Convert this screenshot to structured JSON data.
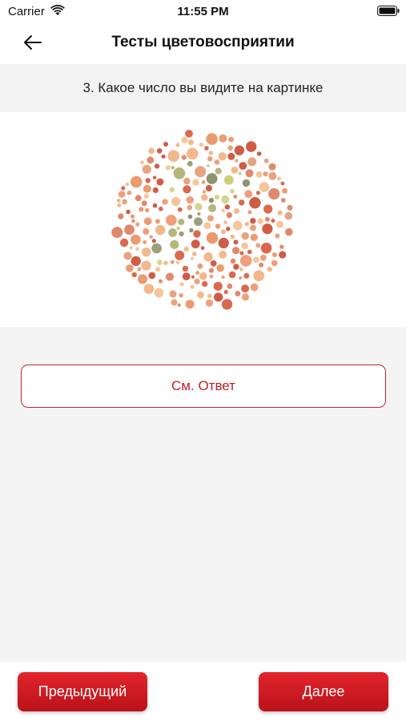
{
  "status_bar": {
    "carrier": "Carrier",
    "time": "11:55 PM",
    "icons": [
      "wifi-icon",
      "battery-icon"
    ]
  },
  "nav": {
    "title": "Тесты цветовосприятии",
    "back_icon": "arrow-left-icon"
  },
  "question": {
    "text": "3. Какое число вы видите на картинке"
  },
  "plate": {
    "icon": "ishihara-color-plate",
    "background_colors": [
      "#e08a6b",
      "#ef9f7c",
      "#f2b98c",
      "#d9694f",
      "#e7a37f",
      "#f5c59b",
      "#cf5d45",
      "#eb9b70"
    ],
    "figure_colors": [
      "#9aa07a",
      "#b6b57c",
      "#c9cf77",
      "#8e9470",
      "#d3d68d"
    ]
  },
  "answer_button": {
    "label": "См. Ответ"
  },
  "footer": {
    "prev_label": "Предыдущий",
    "next_label": "Далее"
  },
  "colors": {
    "accent": "#c8232c",
    "button_gradient_top": "#e2252b",
    "button_gradient_bottom": "#b9121a",
    "question_bg": "#f3f3f3",
    "content_bg": "#f4f4f4"
  }
}
